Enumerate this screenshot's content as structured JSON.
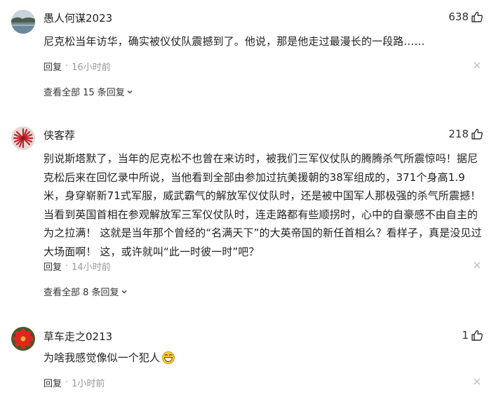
{
  "comments": [
    {
      "username": "愚人何谋2023",
      "likes": "638",
      "text": "尼克松当年访华，确实被仪仗队震撼到了。他说，那是他走过最漫长的一段路……",
      "reply_label": "回复",
      "separator": "·",
      "time": "16小时前",
      "view_all": "查看全部 15 条回复",
      "avatar_icon": "lake-landscape-avatar-icon"
    },
    {
      "username": "侠客荐",
      "likes": "218",
      "text": "别说斯塔默了，当年的尼克松不也曾在来访时，被我们三军仪仗队的腾腾杀气所震惊吗！据尼克松后来在回忆录中所说，当他看到全部由参加过抗美援朝的38军组成的，371个身高1.9米，身穿崭新71式军服，威武霸气的解放军仪仗队时，还是被中国军人那极强的杀气所震撼！ 当看到英国首相在参观解放军三军仪仗队时，连走路都有些顺拐时，心中的自豪感不由自主的为之拉满！ 这就是当年那个曾经的“名满天下”的大英帝国的新任首相么？看样子，真是没见过大场面啊！ 这，或许就叫“此一时彼一时”吧？",
      "reply_label": "回复",
      "separator": "·",
      "time": "14小时前",
      "view_all": "查看全部 8 条回复",
      "avatar_icon": "red-flower-avatar-icon"
    },
    {
      "username": "草车走之0213",
      "likes": "1",
      "text": "为啥我感觉像似一个犯人",
      "emoji_icon": "grin-emoji-icon",
      "reply_label": "回复",
      "separator": "·",
      "time": "1小时前",
      "avatar_icon": "red-flower-avatar-icon"
    }
  ],
  "icons": {
    "like": "thumbs-up-icon",
    "close": "close-icon",
    "expand": "chevron-down-icon"
  },
  "colors": {
    "text": "#222222",
    "meta": "#999999",
    "background": "#ffffff"
  }
}
